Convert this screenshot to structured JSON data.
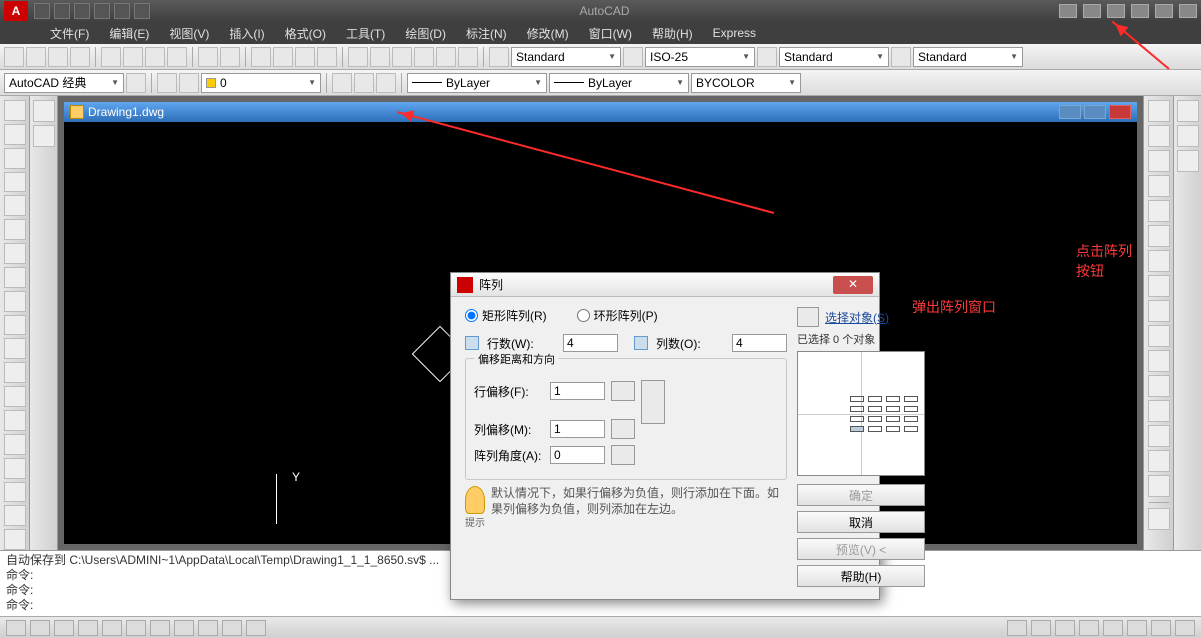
{
  "app": {
    "title": "AutoCAD"
  },
  "menus": [
    "文件(F)",
    "编辑(E)",
    "视图(V)",
    "插入(I)",
    "格式(O)",
    "工具(T)",
    "绘图(D)",
    "标注(N)",
    "修改(M)",
    "窗口(W)",
    "帮助(H)",
    "Express"
  ],
  "styles": {
    "workspace": "AutoCAD 经典",
    "text_style": "Standard",
    "dim_style": "ISO-25",
    "table_style": "Standard",
    "ml_style": "Standard",
    "layer_filter": "ByLayer",
    "lineweight": "ByLayer",
    "color": "BYCOLOR",
    "layer_zero": "0"
  },
  "dwg": {
    "name": "Drawing1.dwg",
    "ucs_y": "Y"
  },
  "dialog": {
    "title": "阵列",
    "rect_radio": "矩形阵列(R)",
    "polar_radio": "环形阵列(P)",
    "select_objects": "选择对象(S)",
    "selected_status": "已选择 0 个对象",
    "rows_label": "行数(W):",
    "rows_value": "4",
    "cols_label": "列数(O):",
    "cols_value": "4",
    "offset_legend": "偏移距离和方向",
    "row_offset_label": "行偏移(F):",
    "row_offset_value": "1",
    "col_offset_label": "列偏移(M):",
    "col_offset_value": "1",
    "angle_label": "阵列角度(A):",
    "angle_value": "0",
    "tip_label": "提示",
    "tip_text": "默认情况下，如果行偏移为负值，则行添加在下面。如果列偏移为负值，则列添加在左边。",
    "ok": "确定",
    "cancel": "取消",
    "preview": "预览(V) <",
    "help": "帮助(H)"
  },
  "annotations": {
    "click_array": "点击阵列按钮",
    "popup_array": "弹出阵列窗口"
  },
  "cmd": {
    "autosave": "自动保存到 C:\\Users\\ADMINI~1\\AppData\\Local\\Temp\\Drawing1_1_1_8650.sv$ ...",
    "prompt1": "命令:",
    "prompt2": "命令:",
    "prompt3": "命令:"
  }
}
